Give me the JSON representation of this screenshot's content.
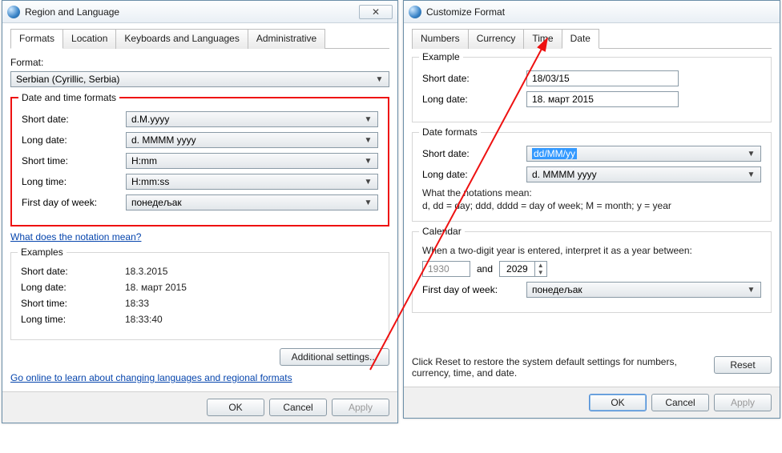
{
  "left": {
    "title": "Region and Language",
    "close_glyph": "⤨",
    "tabs": [
      "Formats",
      "Location",
      "Keyboards and Languages",
      "Administrative"
    ],
    "active_tab": 0,
    "format_label": "Format:",
    "format_value": "Serbian (Cyrillic, Serbia)",
    "group1_title": "Date and time formats",
    "rows1": {
      "short_date": {
        "label": "Short date:",
        "value": "d.M.yyyy"
      },
      "long_date": {
        "label": "Long date:",
        "value": "d. MMMM yyyy"
      },
      "short_time": {
        "label": "Short time:",
        "value": "H:mm"
      },
      "long_time": {
        "label": "Long time:",
        "value": "H:mm:ss"
      },
      "first_day": {
        "label": "First day of week:",
        "value": "понедељак"
      }
    },
    "notation_link": "What does the notation mean?",
    "examples_title": "Examples",
    "examples": {
      "short_date": {
        "label": "Short date:",
        "value": "18.3.2015"
      },
      "long_date": {
        "label": "Long date:",
        "value": "18. март 2015"
      },
      "short_time": {
        "label": "Short time:",
        "value": "18:33"
      },
      "long_time": {
        "label": "Long time:",
        "value": "18:33:40"
      }
    },
    "additional_btn": "Additional settings...",
    "online_link": "Go online to learn about changing languages and regional formats",
    "buttons": {
      "ok": "OK",
      "cancel": "Cancel",
      "apply": "Apply"
    }
  },
  "right": {
    "title": "Customize Format",
    "tabs": [
      "Numbers",
      "Currency",
      "Time",
      "Date"
    ],
    "active_tab": 3,
    "example_title": "Example",
    "example": {
      "short_date": {
        "label": "Short date:",
        "value": "18/03/15"
      },
      "long_date": {
        "label": "Long date:",
        "value": "18. март 2015"
      }
    },
    "dateformats_title": "Date formats",
    "dateformats": {
      "short_date": {
        "label": "Short date:",
        "value": "dd/MM/yy"
      },
      "long_date": {
        "label": "Long date:",
        "value": "d. MMMM yyyy"
      }
    },
    "notation_heading": "What the notations mean:",
    "notation_body": "d, dd = day;  ddd, dddd = day of week;  M = month;  y = year",
    "calendar_title": "Calendar",
    "calendar": {
      "sentence": "When a two-digit year is entered, interpret it as a year between:",
      "year_from": "1930",
      "and": "and",
      "year_to": "2029",
      "first_day_label": "First day of week:",
      "first_day_value": "понедељак"
    },
    "reset_note": "Click Reset to restore the system default settings for numbers, currency, time, and date.",
    "reset_btn": "Reset",
    "buttons": {
      "ok": "OK",
      "cancel": "Cancel",
      "apply": "Apply"
    }
  }
}
